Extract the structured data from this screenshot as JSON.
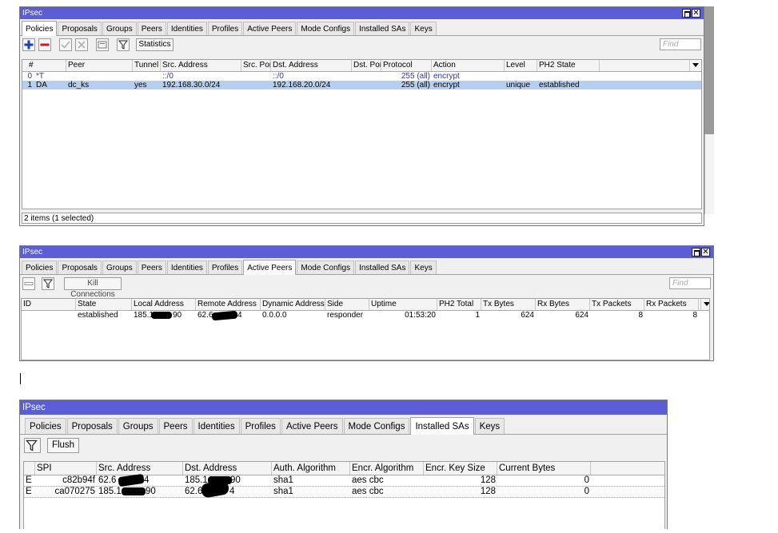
{
  "window1": {
    "title": "IPsec",
    "tabs": [
      "Policies",
      "Proposals",
      "Groups",
      "Peers",
      "Identities",
      "Profiles",
      "Active Peers",
      "Mode Configs",
      "Installed SAs",
      "Keys"
    ],
    "toolbar": {
      "statistics_label": "Statistics",
      "find_placeholder": "Find"
    },
    "columns": [
      "#",
      "Peer",
      "Tunnel",
      "Src. Address",
      "Src. Port",
      "Dst. Address",
      "Dst. Port",
      "Protocol",
      "Action",
      "Level",
      "PH2 State"
    ],
    "rows": [
      {
        "num": "0",
        "flags": "*T",
        "peer": "",
        "tunnel": "",
        "src": "::/0",
        "sport": "",
        "dst": "::/0",
        "dport": "",
        "protocol": "255 (all)",
        "action": "encrypt",
        "level": "",
        "ph2": ""
      },
      {
        "num": "1",
        "flags": "DA",
        "peer": "dc_ks",
        "tunnel": "yes",
        "src": "192.168.30.0/24",
        "sport": "",
        "dst": "192.168.20.0/24",
        "dport": "",
        "protocol": "255 (all)",
        "action": "encrypt",
        "level": "unique",
        "ph2": "established"
      }
    ],
    "status": "2 items (1 selected)"
  },
  "window2": {
    "title": "IPsec",
    "tabs": [
      "Policies",
      "Proposals",
      "Groups",
      "Peers",
      "Identities",
      "Profiles",
      "Active Peers",
      "Mode Configs",
      "Installed SAs",
      "Keys"
    ],
    "toolbar": {
      "kill_label": "Kill Connections",
      "find_placeholder": "Find"
    },
    "columns": [
      "ID",
      "State",
      "Local Address",
      "Remote Address",
      "Dynamic Address",
      "Side",
      "Uptime",
      "PH2 Total",
      "Tx Bytes",
      "Rx Bytes",
      "Tx Packets",
      "Rx Packets"
    ],
    "rows": [
      {
        "id": "",
        "state": "established",
        "local": "185.1",
        "local_end": "90",
        "remote": "62.6",
        "remote_end": "4",
        "dynamic": "0.0.0.0",
        "side": "responder",
        "uptime": "01:53:20",
        "ph2": "1",
        "tx_bytes": "624",
        "rx_bytes": "624",
        "tx_packets": "8",
        "rx_packets": "8"
      }
    ]
  },
  "window3": {
    "title": "IPsec",
    "tabs": [
      "Policies",
      "Proposals",
      "Groups",
      "Peers",
      "Identities",
      "Profiles",
      "Active Peers",
      "Mode Configs",
      "Installed SAs",
      "Keys"
    ],
    "toolbar": {
      "flush_label": "Flush"
    },
    "columns": [
      "SPI",
      "Src. Address",
      "Dst. Address",
      "Auth. Algorithm",
      "Encr. Algorithm",
      "Encr. Key Size",
      "Current Bytes"
    ],
    "rows": [
      {
        "flag": "E",
        "spi": "c82b94f",
        "src": "62.6",
        "src_end": "4",
        "dst": "185.1",
        "dst_end": "90",
        "auth": "sha1",
        "encr": "aes cbc",
        "keysize": "128",
        "bytes": "0"
      },
      {
        "flag": "E",
        "spi": "ca070275",
        "src": "185.1",
        "src_end": "90",
        "dst": "62.6",
        "dst_end": "4",
        "auth": "sha1",
        "encr": "aes cbc",
        "keysize": "128",
        "bytes": "0"
      }
    ]
  }
}
